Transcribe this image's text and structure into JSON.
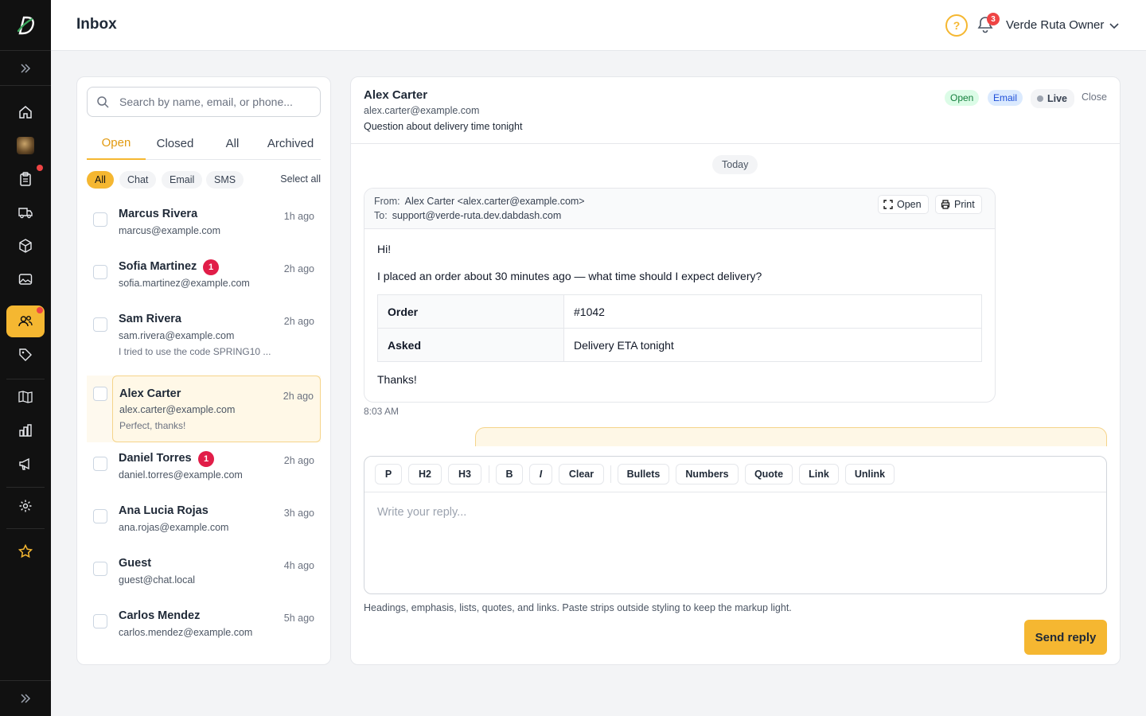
{
  "header": {
    "title": "Inbox",
    "help_icon": "help-circle-icon",
    "notification_count": "3",
    "user_name": "Verde Ruta Owner"
  },
  "sidebar": {
    "items": [
      {
        "icon": "home-icon"
      },
      {
        "icon": "store-thumbnail"
      },
      {
        "icon": "clipboard-icon",
        "has_dot": true
      },
      {
        "icon": "truck-icon"
      },
      {
        "icon": "box-icon"
      },
      {
        "icon": "image-icon"
      },
      {
        "icon": "users-icon",
        "active": true,
        "has_dot": true
      },
      {
        "icon": "tag-icon"
      },
      {
        "icon": "book-icon"
      },
      {
        "icon": "bar-chart-icon"
      },
      {
        "icon": "megaphone-icon"
      },
      {
        "icon": "gear-icon"
      },
      {
        "icon": "star-icon"
      }
    ]
  },
  "list": {
    "search_placeholder": "Search by name, email, or phone...",
    "tabs": [
      "Open",
      "Closed",
      "All",
      "Archived"
    ],
    "active_tab": "Open",
    "filters": [
      "All",
      "Chat",
      "Email",
      "SMS"
    ],
    "select_all": "Select all",
    "conversations": [
      {
        "name": "Marcus Rivera",
        "email": "marcus@example.com",
        "time": "1h ago",
        "badge": "",
        "preview": ""
      },
      {
        "name": "Sofia Martinez",
        "email": "sofia.martinez@example.com",
        "time": "2h ago",
        "badge": "1",
        "preview": ""
      },
      {
        "name": "Sam Rivera",
        "email": "sam.rivera@example.com",
        "time": "2h ago",
        "badge": "",
        "preview": "I tried to use the code SPRING10 ..."
      },
      {
        "name": "Alex Carter",
        "email": "alex.carter@example.com",
        "time": "2h ago",
        "badge": "",
        "preview": "Perfect, thanks!",
        "selected": true
      },
      {
        "name": "Daniel Torres",
        "email": "daniel.torres@example.com",
        "time": "2h ago",
        "badge": "1",
        "preview": ""
      },
      {
        "name": "Ana Lucia Rojas",
        "email": "ana.rojas@example.com",
        "time": "3h ago",
        "badge": "",
        "preview": ""
      },
      {
        "name": "Guest",
        "email": "guest@chat.local",
        "time": "4h ago",
        "badge": "",
        "preview": ""
      },
      {
        "name": "Carlos Mendez",
        "email": "carlos.mendez@example.com",
        "time": "5h ago",
        "badge": "",
        "preview": ""
      }
    ]
  },
  "detail": {
    "name": "Alex Carter",
    "email": "alex.carter@example.com",
    "subject": "Question about delivery time tonight",
    "status": "Open",
    "channel": "Email",
    "live": "Live",
    "close": "Close",
    "day_label": "Today",
    "message": {
      "from_label": "From:",
      "from": "Alex Carter <alex.carter@example.com>",
      "to_label": "To:",
      "to": "support@verde-ruta.dev.dabdash.com",
      "open_label": "Open",
      "print_label": "Print",
      "greeting": "Hi!",
      "line": "I placed an order about 30 minutes ago — what time should I expect delivery?",
      "table": [
        {
          "key": "Order",
          "value": "#1042"
        },
        {
          "key": "Asked",
          "value": "Delivery ETA tonight"
        }
      ],
      "signoff": "Thanks!",
      "time": "8:03 AM"
    }
  },
  "composer": {
    "buttons": [
      "P",
      "H2",
      "H3",
      "B",
      "I",
      "Clear",
      "Bullets",
      "Numbers",
      "Quote",
      "Link",
      "Unlink"
    ],
    "placeholder": "Write your reply...",
    "hint": "Headings, emphasis, lists, quotes, and links. Paste strips outside styling to keep the markup light.",
    "send_label": "Send reply"
  },
  "colors": {
    "accent": "#f5b731",
    "rail": "#111111",
    "badge": "#e11d48"
  }
}
